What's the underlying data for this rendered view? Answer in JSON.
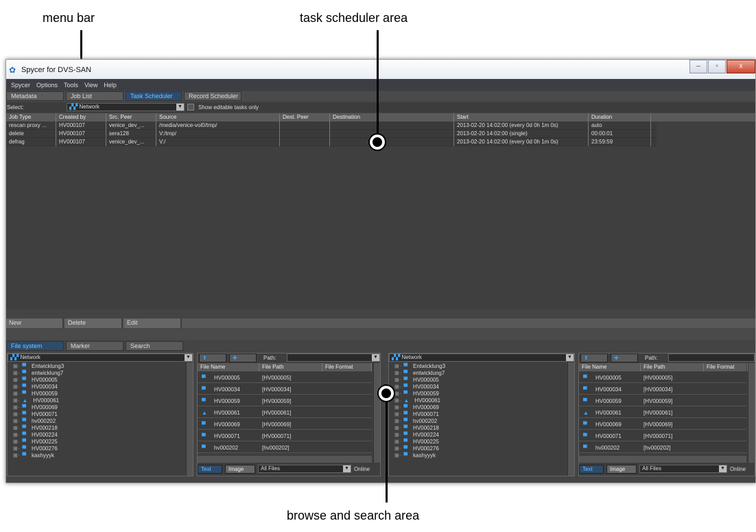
{
  "callouts": {
    "menu_bar": "menu bar",
    "task_scheduler": "task scheduler area",
    "browse_search": "browse and search area"
  },
  "window": {
    "title": "Spycer for DVS-SAN",
    "min": "–",
    "max": "▫",
    "close": "x"
  },
  "menu": [
    "Spycer",
    "Options",
    "Tools",
    "View",
    "Help"
  ],
  "top_tabs": [
    {
      "label": "Metadata",
      "active": false
    },
    {
      "label": "Job List",
      "active": false
    },
    {
      "label": "Task Scheduler",
      "active": true
    },
    {
      "label": "Record Scheduler",
      "active": false
    }
  ],
  "select_row": {
    "label": "Select:",
    "value": "Network",
    "checkbox_label": "Show editable tasks only"
  },
  "grid": {
    "columns": [
      "Job Type",
      "Created by",
      "Src. Peer",
      "Source",
      "Dest. Peer",
      "Destination",
      "Start",
      "Duration"
    ],
    "rows": [
      [
        "rescan proxy ...",
        "HV000107",
        "venice_dev_...",
        "/media/venice-vol0/tmp/",
        "",
        "",
        "2013-02-20 14:02:00 (every 0d 0h 1m 0s)",
        "auto"
      ],
      [
        "delete",
        "HV000107",
        "sera128",
        "V:/tmp/",
        "",
        "",
        "2013-02-20 14:02:00 (single)",
        "00:00:01"
      ],
      [
        "defrag",
        "HV000107",
        "venice_dev_...",
        "V:/",
        "",
        "",
        "2013-02-20 14:02:00 (every 0d 0h 1m 0s)",
        "23:59:59"
      ]
    ]
  },
  "actions": [
    "New",
    "Delete",
    "Edit"
  ],
  "browse_tabs": [
    {
      "label": "File system",
      "active": true
    },
    {
      "label": "Marker",
      "active": false
    },
    {
      "label": "Search",
      "active": false
    }
  ],
  "tree": {
    "root": "Network",
    "items": [
      "Entwicklung3",
      "entwicklung7",
      "HV000005",
      "HV000034",
      "HV000059",
      "HV000061",
      "HV000069",
      "HV000071",
      "hv000202",
      "HV000218",
      "HV000224",
      "HV000225",
      "HV000276",
      "kashyyyk"
    ]
  },
  "filelist": {
    "path_label": "Path:",
    "columns": [
      "File Name",
      "File Path",
      "File Format"
    ],
    "rows": [
      [
        "HV000005",
        "[HV000005]"
      ],
      [
        "HV000034",
        "[HV000034]"
      ],
      [
        "HV000059",
        "[HV000059]"
      ],
      [
        "HV000061",
        "[HV000061]"
      ],
      [
        "HV000069",
        "[HV000069]"
      ],
      [
        "HV000071",
        "[HV000071]"
      ],
      [
        "hv000202",
        "[hv000202]"
      ]
    ],
    "footer": {
      "text": "Text",
      "image": "Image",
      "filter": "All Files",
      "online": "Online"
    }
  }
}
